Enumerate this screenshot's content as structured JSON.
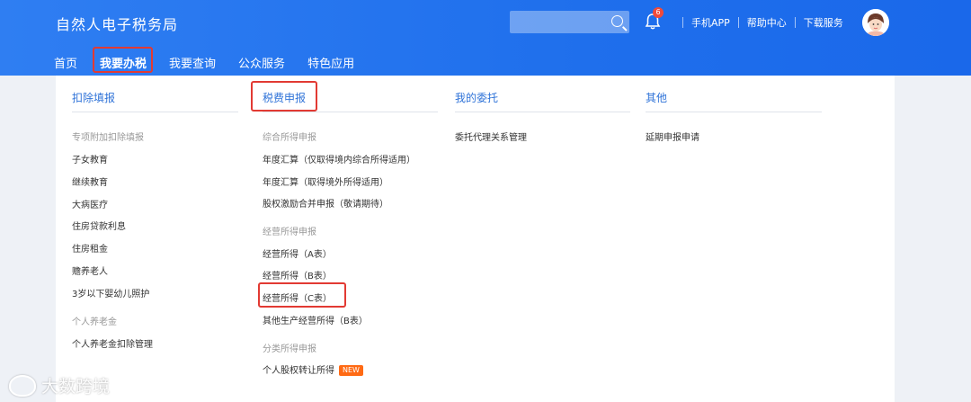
{
  "header": {
    "brand": "自然人电子税务局",
    "search": {
      "placeholder": ""
    },
    "notifications": {
      "count": "6"
    },
    "links": [
      "手机APP",
      "帮助中心",
      "下载服务"
    ]
  },
  "nav": {
    "items": [
      "首页",
      "我要办税",
      "我要查询",
      "公众服务",
      "特色应用"
    ],
    "active": "我要办税"
  },
  "menu": {
    "columns": [
      {
        "title": "扣除填报",
        "groups": [
          {
            "label": "专项附加扣除填报",
            "items": [
              "子女教育",
              "继续教育",
              "大病医疗",
              "住房贷款利息",
              "住房租金",
              "赡养老人",
              "3岁以下婴幼儿照护"
            ]
          },
          {
            "label": "个人养老金",
            "items": [
              "个人养老金扣除管理"
            ]
          }
        ]
      },
      {
        "title": "税费申报",
        "groups": [
          {
            "label": "综合所得申报",
            "items": [
              "年度汇算（仅取得境内综合所得适用）",
              "年度汇算（取得境外所得适用）",
              "股权激励合并申报（敬请期待）"
            ]
          },
          {
            "label": "经营所得申报",
            "items": [
              "经营所得（A表）",
              "经营所得（B表）",
              "经营所得（C表）",
              "其他生产经营所得（B表）"
            ]
          },
          {
            "label": "分类所得申报",
            "items": [
              "个人股权转让所得"
            ]
          }
        ],
        "new_badge": "NEW"
      },
      {
        "title": "我的委托",
        "groups": [
          {
            "items": [
              "委托代理关系管理"
            ]
          }
        ]
      },
      {
        "title": "其他",
        "groups": [
          {
            "items": [
              "延期申报申请"
            ]
          }
        ]
      }
    ]
  },
  "watermark": "大数跨境",
  "colors": {
    "header_blue": "#1f6fec",
    "link_blue": "#2f73d8",
    "highlight_red": "#e23a33",
    "badge_orange": "#ff6a14"
  }
}
